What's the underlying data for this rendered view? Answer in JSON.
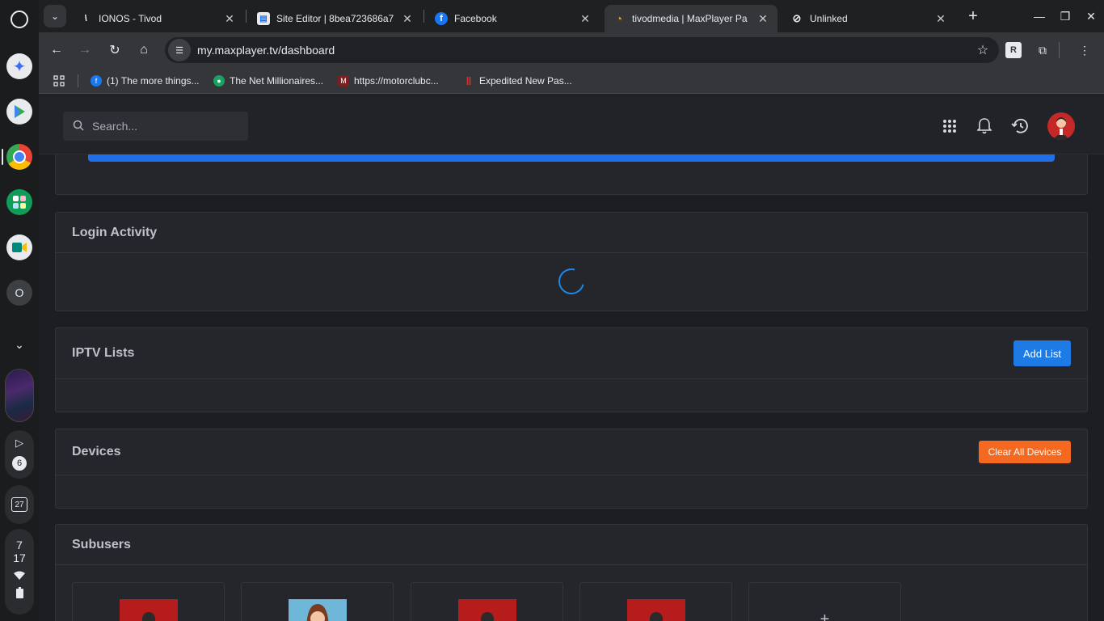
{
  "browser": {
    "tabs": [
      {
        "title": "IONOS - Tivod",
        "favicon": "ionos-icon",
        "fav_char": "\\",
        "fav_bg": "#1f2022",
        "fav_fg": "#ffffff"
      },
      {
        "title": "Site Editor | 8bea723686a7",
        "favicon": "site-editor-icon",
        "fav_char": "▤",
        "fav_bg": "#e8eaed",
        "fav_fg": "#1a73e8"
      },
      {
        "title": "Facebook",
        "favicon": "facebook-icon",
        "fav_char": "f",
        "fav_bg": "#1877f2",
        "fav_fg": "#ffffff"
      },
      {
        "title": "tivodmedia | MaxPlayer Pa",
        "favicon": "maxplayer-icon",
        "fav_char": "◔",
        "fav_bg": "#35363a",
        "fav_fg": "#f29900"
      },
      {
        "title": "Unlinked",
        "favicon": "unlinked-icon",
        "fav_char": "⊘",
        "fav_bg": "#1f2022",
        "fav_fg": "#e8eaed"
      }
    ],
    "url": "my.maxplayer.tv/dashboard",
    "bookmarks": [
      {
        "label": "(1) The more things...",
        "icon": "facebook-icon",
        "color": "#1877f2",
        "char": "f"
      },
      {
        "label": "The Net Millionaires...",
        "icon": "net-millionaires-icon",
        "color": "#1aa260",
        "char": "●"
      },
      {
        "label": "https://motorclubc...",
        "icon": "motorclub-icon",
        "color": "#7a2020",
        "char": "M"
      },
      {
        "label": "Expedited New Pas...",
        "icon": "passport-icon",
        "color": "#d93025",
        "char": "‖"
      }
    ]
  },
  "shelf": {
    "notification_count": "6",
    "calendar_day": "27",
    "time_hour": "7",
    "time_minute": "17"
  },
  "topbar": {
    "search_placeholder": "Search..."
  },
  "sections": {
    "login_activity": "Login Activity",
    "iptv_lists": "IPTV Lists",
    "add_list_label": "Add List",
    "devices": "Devices",
    "clear_devices_label": "Clear All Devices",
    "subusers": "Subusers",
    "add_subuser_label": "+"
  },
  "colors": {
    "accent_blue": "#1e7be6",
    "accent_orange": "#f4681f",
    "progress_blue": "#1e6fe8"
  }
}
